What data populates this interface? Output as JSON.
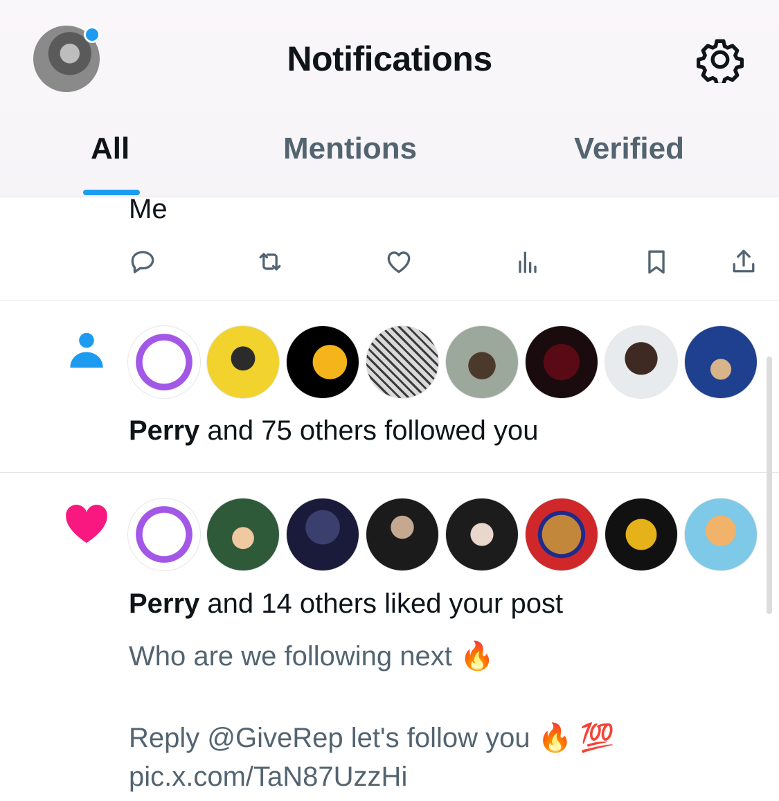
{
  "header": {
    "title": "Notifications",
    "tabs": [
      {
        "label": "All",
        "active": true
      },
      {
        "label": "Mentions",
        "active": false
      },
      {
        "label": "Verified",
        "active": false
      }
    ],
    "accent_color": "#1d9bf0"
  },
  "previous_post": {
    "text_tail": "Me",
    "actions": [
      "reply-icon",
      "repost-icon",
      "like-icon",
      "views-icon",
      "bookmark-icon",
      "share-icon"
    ]
  },
  "follow_notification": {
    "icon": "person-icon",
    "icon_color": "#1d9bf0",
    "name": "Perry",
    "rest": " and 75 others followed you",
    "avatars_count": 8
  },
  "like_notification": {
    "icon": "heart-icon",
    "icon_color": "#f91880",
    "name": "Perry",
    "rest": " and 14 others liked your post",
    "post_line1": "Who are we following next 🔥",
    "post_line2": "Reply @GiveRep let's follow you 🔥 💯",
    "post_link": "pic.x.com/TaN87UzzHi",
    "avatars_count": 8
  }
}
